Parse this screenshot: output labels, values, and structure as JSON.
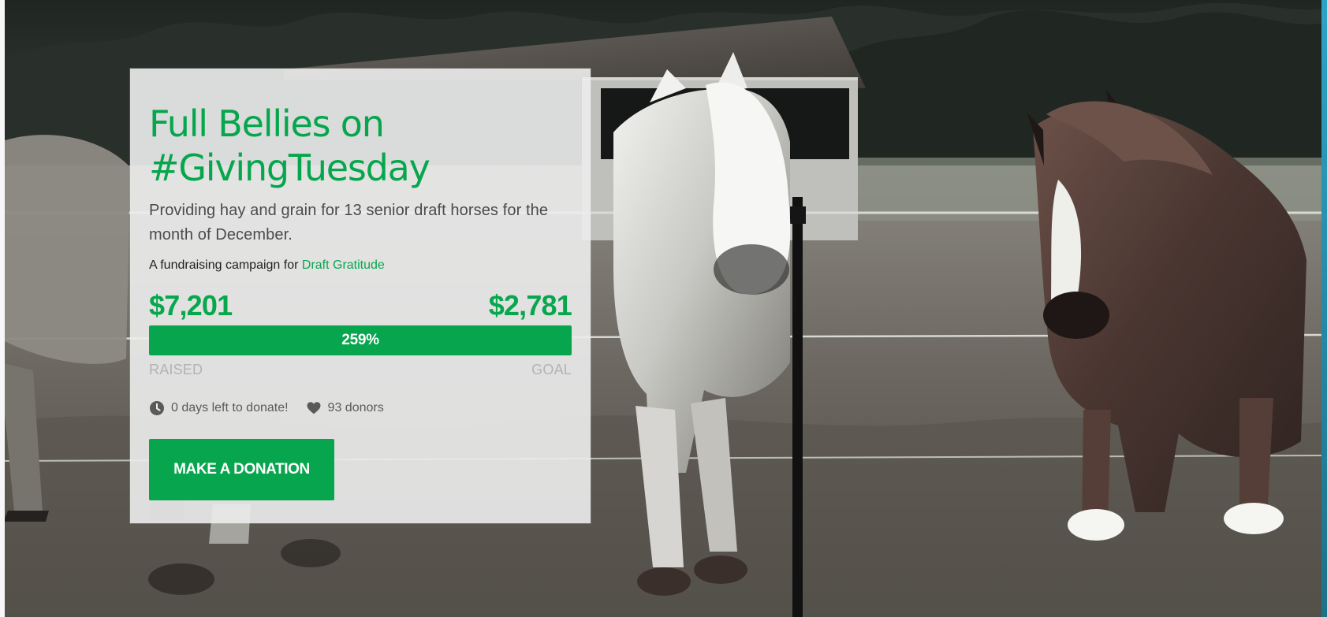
{
  "campaign": {
    "title": "Full Bellies on\n#GivingTuesday",
    "description": "Providing hay and grain for 13 senior draft horses for the month of December.",
    "organization_prefix": "A fundraising campaign for ",
    "organization_name": "Draft Gratitude",
    "raised_amount": "$7,201",
    "goal_amount": "$2,781",
    "progress_text": "259%",
    "progress_fraction": 1,
    "raised_label": "RAISED",
    "goal_label": "GOAL",
    "days_left_text": "0 days left to donate!",
    "donors_text": "93 donors",
    "donate_button_label": "MAKE A DONATION"
  },
  "icons": {
    "time": "clock-icon",
    "donors": "heart-icon"
  },
  "colors": {
    "accent": "#07a54d",
    "secondary_text": "#5a5a5a",
    "muted_label": "#b3b3b3",
    "card_background": "#ececec",
    "edge_accent": "#2aa5c6"
  }
}
